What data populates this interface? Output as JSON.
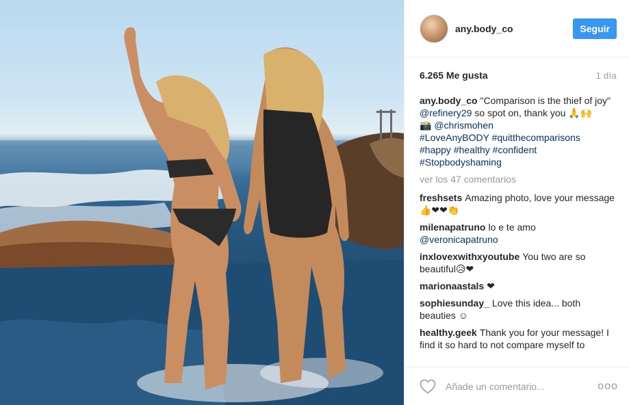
{
  "post": {
    "username": "any.body_co",
    "follow_label": "Seguir",
    "likes": "6.265 Me gusta",
    "time": "1 día",
    "caption": {
      "author": "any.body_co",
      "line1": "\"Comparison is the thief of joy\"",
      "mention1": "@refinery29",
      "line2": " so spot on, thank you 🙏🙌",
      "camera": "📸 ",
      "mention2": "@chrismohen",
      "tags1": "#LoveAnyBODY #quitthecomparisons",
      "tags2": "#happy #healthy #confident",
      "tags3": "#Stopbodyshaming"
    },
    "view_more": "ver los 47 comentarios",
    "comments": [
      {
        "user": "freshsets",
        "text": "Amazing photo, love your message 👍❤❤👏"
      },
      {
        "user": "milenapatruno",
        "text": "lo e te amo",
        "mention": "@veronicapatruno"
      },
      {
        "user": "inxlovexwithxyoutube",
        "text": "You two are so beautiful😥❤"
      },
      {
        "user": "marionaastals",
        "text": "❤"
      },
      {
        "user": "sophiesunday_",
        "text": "Love this idea... both beauties ☺"
      },
      {
        "user": "healthy.geek",
        "text": "Thank you for your message! I find it so hard to not compare myself to"
      }
    ],
    "add_comment_placeholder": "Añade un comentario...",
    "more_label": "ooo"
  },
  "icons": {
    "heart": "heart-icon",
    "more": "more-options-icon"
  },
  "colors": {
    "follow_button": "#3897f0",
    "link": "#003569",
    "muted": "#999999"
  }
}
